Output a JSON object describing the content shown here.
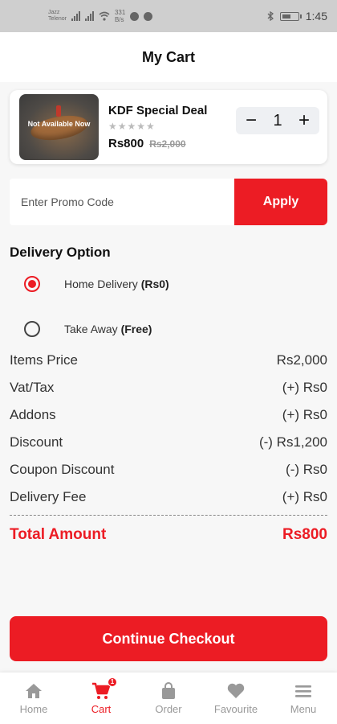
{
  "status_bar": {
    "carrier_1": "Jazz",
    "carrier_2": "Telenor",
    "speed_value": "331",
    "speed_unit": "B/s",
    "time": "1:45"
  },
  "header": {
    "title": "My Cart"
  },
  "cart_item": {
    "name": "KDF Special Deal",
    "rating": 0,
    "rating_max": 5,
    "stars": "★★★★★",
    "price": "Rs800",
    "old_price": "Rs2,000",
    "availability": "Not Available Now",
    "quantity": "1",
    "decrease": "−",
    "increase": "+"
  },
  "promo": {
    "placeholder": "Enter Promo Code",
    "apply_label": "Apply"
  },
  "delivery": {
    "title": "Delivery Option",
    "options": [
      {
        "label": "Home Delivery",
        "price": "(Rs0)",
        "selected": true
      },
      {
        "label": "Take Away",
        "price": "(Free)",
        "selected": false
      }
    ]
  },
  "summary": {
    "rows": [
      {
        "label": "Items Price",
        "value": "Rs2,000"
      },
      {
        "label": "Vat/Tax",
        "value": "(+) Rs0"
      },
      {
        "label": "Addons",
        "value": "(+) Rs0"
      },
      {
        "label": "Discount",
        "value": "(-) Rs1,200"
      },
      {
        "label": "Coupon Discount",
        "value": "(-) Rs0"
      },
      {
        "label": "Delivery Fee",
        "value": "(+) Rs0"
      }
    ],
    "total_label": "Total Amount",
    "total_value": "Rs800"
  },
  "checkout": {
    "label": "Continue Checkout"
  },
  "nav": {
    "items": [
      {
        "label": "Home",
        "icon": "home-icon"
      },
      {
        "label": "Cart",
        "icon": "cart-icon",
        "badge": "1",
        "active": true
      },
      {
        "label": "Order",
        "icon": "bag-icon"
      },
      {
        "label": "Favourite",
        "icon": "heart-icon"
      },
      {
        "label": "Menu",
        "icon": "menu-icon"
      }
    ]
  },
  "colors": {
    "accent": "#ec1c24",
    "inactive": "#999999"
  }
}
